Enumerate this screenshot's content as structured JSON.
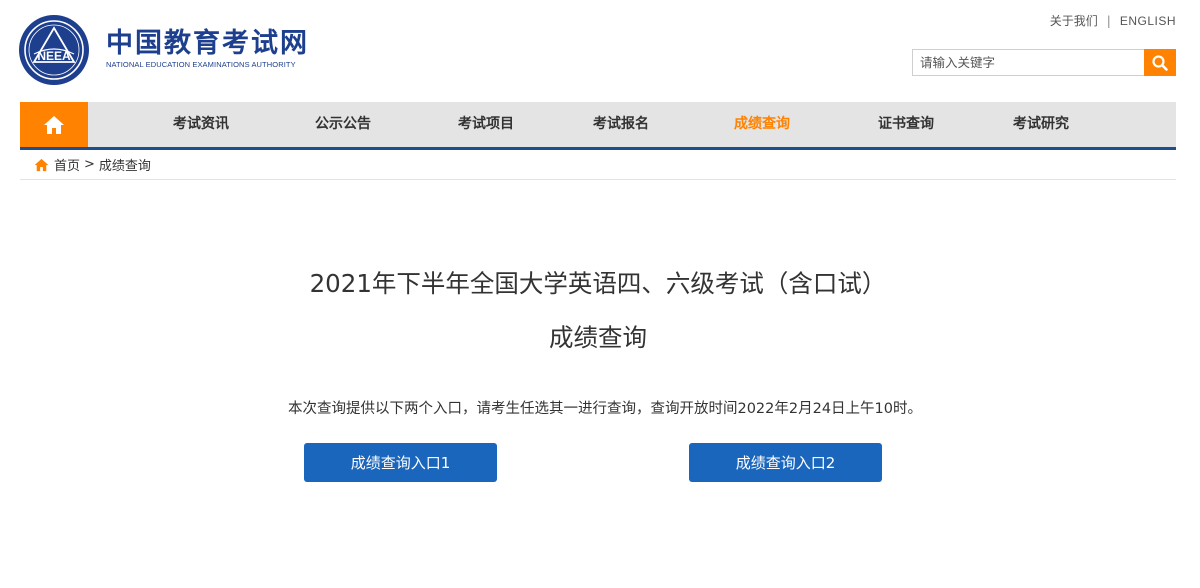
{
  "header": {
    "logo_cn": "中国教育考试网",
    "logo_en": "NATIONAL EDUCATION EXAMINATIONS AUTHORITY",
    "logo_badge": "NEEA",
    "about_label": "关于我们",
    "separator": "|",
    "english_label": "ENGLISH",
    "search": {
      "placeholder": "请输入关键字",
      "button_icon": "search-icon"
    }
  },
  "nav": {
    "home_icon": "home-icon",
    "items": [
      {
        "label": "考试资讯"
      },
      {
        "label": "公示公告"
      },
      {
        "label": "考试项目"
      },
      {
        "label": "考试报名"
      },
      {
        "label": "成绩查询",
        "active": true
      },
      {
        "label": "证书查询"
      },
      {
        "label": "考试研究"
      }
    ],
    "accent_color": "#ff8200",
    "underline_color": "#1d4e8f"
  },
  "breadcrumb": {
    "home_label": "首页",
    "separator": ">",
    "current": "成绩查询"
  },
  "main": {
    "title_line1": "2021年下半年全国大学英语四、六级考试（含口试）",
    "title_line2": "成绩查询",
    "description": "本次查询提供以下两个入口，请考生任选其一进行查询，查询开放时间2022年2月24日上午10时。",
    "entry1_label": "成绩查询入口1",
    "entry2_label": "成绩查询入口2",
    "button_color": "#1b66bd"
  }
}
